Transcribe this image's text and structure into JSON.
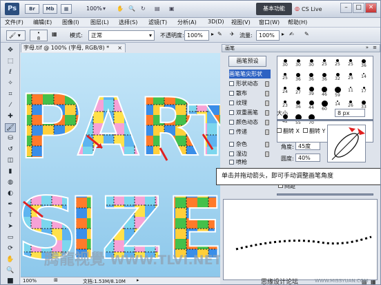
{
  "app": {
    "logo": "Ps",
    "br_label": "Br",
    "mb_label": "Mb",
    "zoom": "100%",
    "workspace": "基本功能",
    "cs_live": "CS Live"
  },
  "menu": [
    "文件(F)",
    "编辑(E)",
    "图像(I)",
    "图层(L)",
    "选择(S)",
    "滤镜(T)",
    "分析(A)",
    "3D(D)",
    "视图(V)",
    "窗口(W)",
    "帮助(H)"
  ],
  "options": {
    "brush_size": "8",
    "mode_label": "模式:",
    "mode_value": "正常",
    "opacity_label": "不透明度:",
    "opacity_value": "100%",
    "flow_label": "流量:",
    "flow_value": "100%"
  },
  "document": {
    "tab": "字母.tif @ 100% (字母, RGB/8) *",
    "zoom": "100%",
    "status": "文档:1.53M/8.10M"
  },
  "canvas_letters": [
    "P",
    "A",
    "R",
    "T",
    "Y",
    "S",
    "I",
    "Z",
    "E"
  ],
  "panel": {
    "tab": "画笔",
    "preset_button": "画笔预设",
    "options": [
      "画笔笔尖形状",
      "形状动态",
      "散布",
      "纹理",
      "双重画笔",
      "颜色动态",
      "传递",
      "杂色",
      "湿边",
      "喷枪"
    ],
    "brush_sizes": [
      "30",
      "30",
      "30",
      "25",
      "25",
      "25",
      "36",
      "25",
      "36",
      "36",
      "36",
      "32",
      "25",
      "14",
      "24",
      "27",
      "39",
      "46",
      "59",
      "11",
      "17",
      "23",
      "36",
      "44",
      "60",
      "14",
      "26",
      "33",
      "42",
      "55",
      "70"
    ],
    "size_label": "大小",
    "size_value": "8 px",
    "flip_x": "翻转 X",
    "flip_y": "翻转 Y",
    "angle_label": "角度:",
    "angle_value": "45度",
    "roundness_label": "圆度:",
    "roundness_value": "40%",
    "spacing_label": "间距"
  },
  "callout": "单击并拖动箭头，即可手动调整画笔角度",
  "watermark": {
    "left": "腾龍视覺",
    "url": "WWW.TLVI.NET",
    "bottom_url": "WWW.MISSYUAN.COM",
    "forum": "思缘设计论坛"
  },
  "colors": {
    "accent": "#e02020",
    "panel_bg": "#dee3eb",
    "canvas_sky": "#a9d8f1"
  }
}
